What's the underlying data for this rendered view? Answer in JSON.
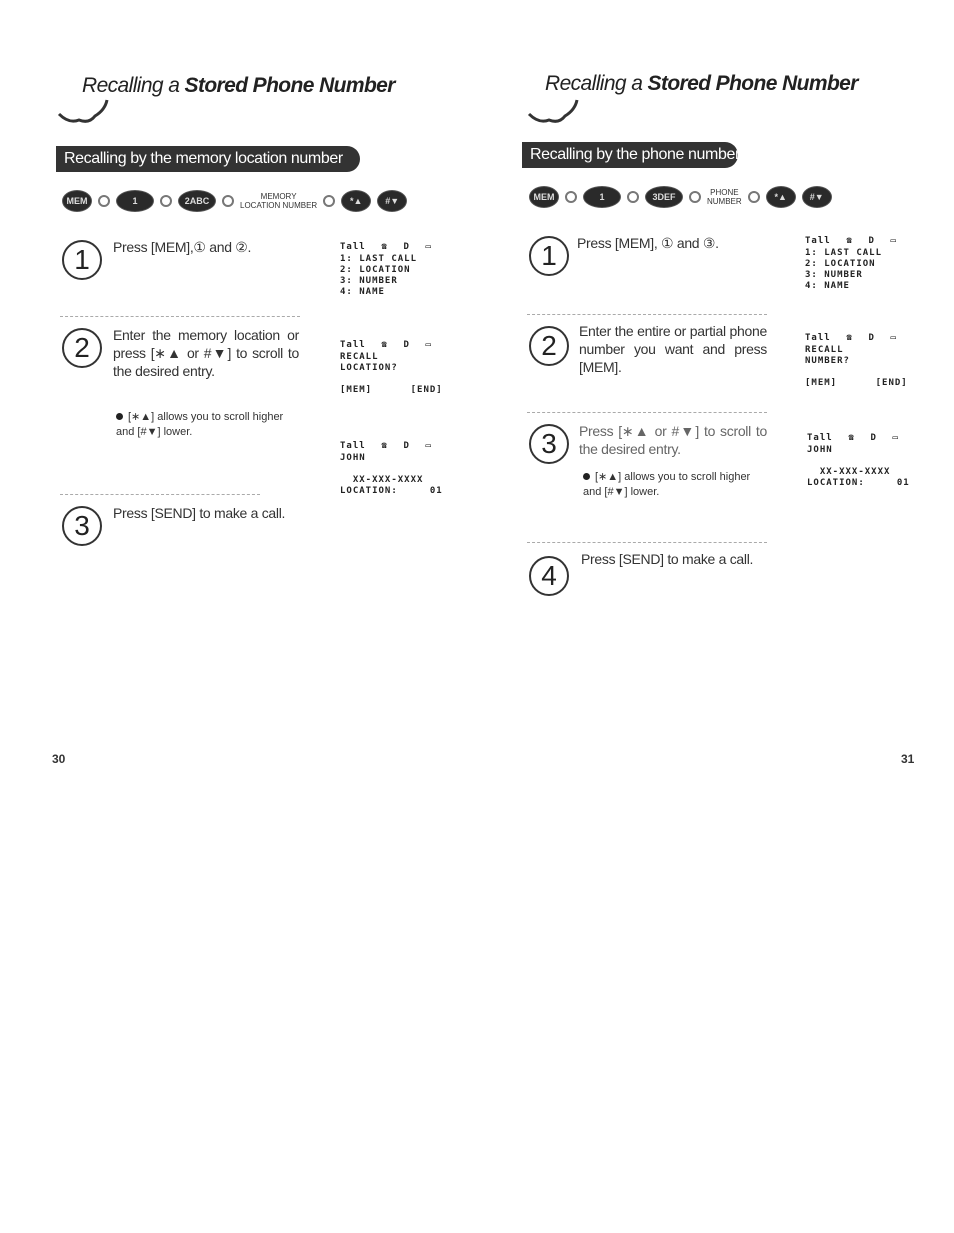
{
  "left_page": {
    "title_part1": "Recalling a ",
    "title_part2": "Stored Phone Number",
    "banner": "Recalling by the memory location number",
    "keys": {
      "mem": "MEM",
      "k1": "1",
      "k2": "2ABC",
      "label_line1": "MEMORY",
      "label_line2": "LOCATION NUMBER",
      "star_up": "*▲",
      "hash_down": "#▼"
    },
    "steps": [
      {
        "num": "1",
        "text": "Press [MEM],① and ②."
      },
      {
        "num": "2",
        "text": "Enter the memory location or press [∗▲ or #▼] to scroll to the desired entry."
      },
      {
        "num": "3",
        "text": "Press [SEND] to make a call."
      }
    ],
    "bullet": "[∗▲] allows you to scroll higher and [#▼] lower.",
    "lcd1": {
      "icons": [
        "Tall",
        "☎",
        "D",
        "▭"
      ],
      "rows": [
        "1: LAST CALL",
        "2: LOCATION",
        "3: NUMBER",
        "4: NAME"
      ]
    },
    "lcd2": {
      "icons": [
        "Tall",
        "☎",
        "D",
        "▭"
      ],
      "rows": [
        "RECALL",
        "LOCATION?",
        "",
        "[MEM]      [END]"
      ]
    },
    "lcd3": {
      "icons": [
        "Tall",
        "☎",
        "D",
        "▭"
      ],
      "rows": [
        "JOHN",
        "",
        "  XX-XXX-XXXX",
        "LOCATION:     01"
      ]
    },
    "page_number": "30"
  },
  "right_page": {
    "title_part1": "Recalling a ",
    "title_part2": "Stored Phone Number",
    "banner": "Recalling by the phone number",
    "keys": {
      "mem": "MEM",
      "k1": "1",
      "k3": "3DEF",
      "label_line1": "PHONE",
      "label_line2": "NUMBER",
      "star_up": "*▲",
      "hash_down": "#▼"
    },
    "steps": [
      {
        "num": "1",
        "text": "Press [MEM], ① and ③."
      },
      {
        "num": "2",
        "text": "Enter the entire or partial phone number you want and press [MEM]."
      },
      {
        "num": "3",
        "text": "Press [∗▲ or #▼] to scroll to the desired entry."
      },
      {
        "num": "4",
        "text": "Press [SEND] to make a call."
      }
    ],
    "bullet": "[∗▲] allows you to scroll higher and [#▼] lower.",
    "lcd1": {
      "icons": [
        "Tall",
        "☎",
        "D",
        "▭"
      ],
      "rows": [
        "1: LAST CALL",
        "2: LOCATION",
        "3: NUMBER",
        "4: NAME"
      ]
    },
    "lcd2": {
      "icons": [
        "Tall",
        "☎",
        "D",
        "▭"
      ],
      "rows": [
        "RECALL",
        "NUMBER?",
        "",
        "[MEM]      [END]"
      ]
    },
    "lcd3": {
      "icons": [
        "Tall",
        "☎",
        "D",
        "▭"
      ],
      "rows": [
        "JOHN",
        "",
        "  XX-XXX-XXXX",
        "LOCATION:     01"
      ]
    },
    "page_number": "31"
  }
}
